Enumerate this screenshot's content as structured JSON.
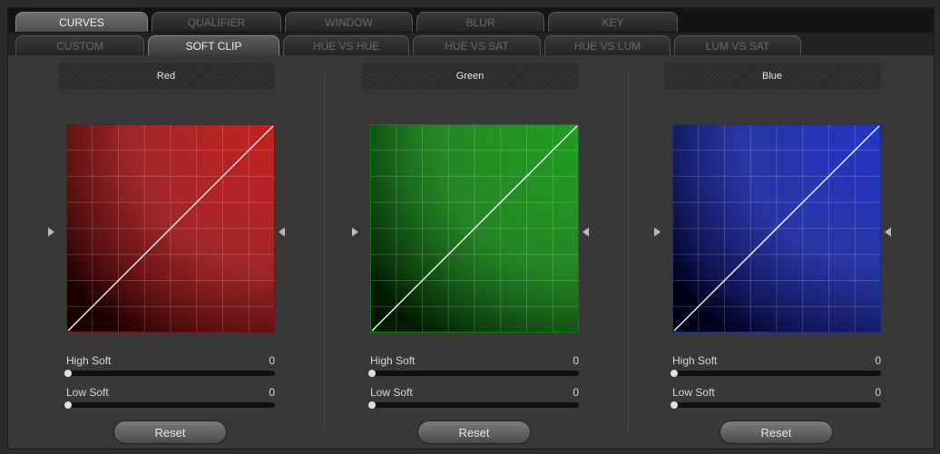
{
  "tabs_primary": [
    {
      "label": "CURVES",
      "active": true
    },
    {
      "label": "QUALIFIER",
      "active": false
    },
    {
      "label": "WINDOW",
      "active": false
    },
    {
      "label": "BLUR",
      "active": false
    },
    {
      "label": "KEY",
      "active": false
    }
  ],
  "tabs_secondary": [
    {
      "label": "CUSTOM",
      "active": false
    },
    {
      "label": "SOFT CLIP",
      "active": true
    },
    {
      "label": "HUE VS HUE",
      "active": false
    },
    {
      "label": "HUE VS SAT",
      "active": false
    },
    {
      "label": "HUE VS LUM",
      "active": false
    },
    {
      "label": "LUM VS SAT",
      "active": false
    }
  ],
  "panels": [
    {
      "title": "Red",
      "color_dark": "#1a0000",
      "color_light": "#c42020",
      "border_color": "#7a1010",
      "high_soft": {
        "label": "High Soft",
        "value": "0"
      },
      "low_soft": {
        "label": "Low Soft",
        "value": "0"
      },
      "reset_label": "Reset"
    },
    {
      "title": "Green",
      "color_dark": "#001a00",
      "color_light": "#1fa01f",
      "border_color": "#127a12",
      "high_soft": {
        "label": "High Soft",
        "value": "0"
      },
      "low_soft": {
        "label": "Low Soft",
        "value": "0"
      },
      "reset_label": "Reset"
    },
    {
      "title": "Blue",
      "color_dark": "#00001a",
      "color_light": "#2235c8",
      "border_color": "#1a2a9a",
      "high_soft": {
        "label": "High Soft",
        "value": "0"
      },
      "low_soft": {
        "label": "Low Soft",
        "value": "0"
      },
      "reset_label": "Reset"
    }
  ]
}
